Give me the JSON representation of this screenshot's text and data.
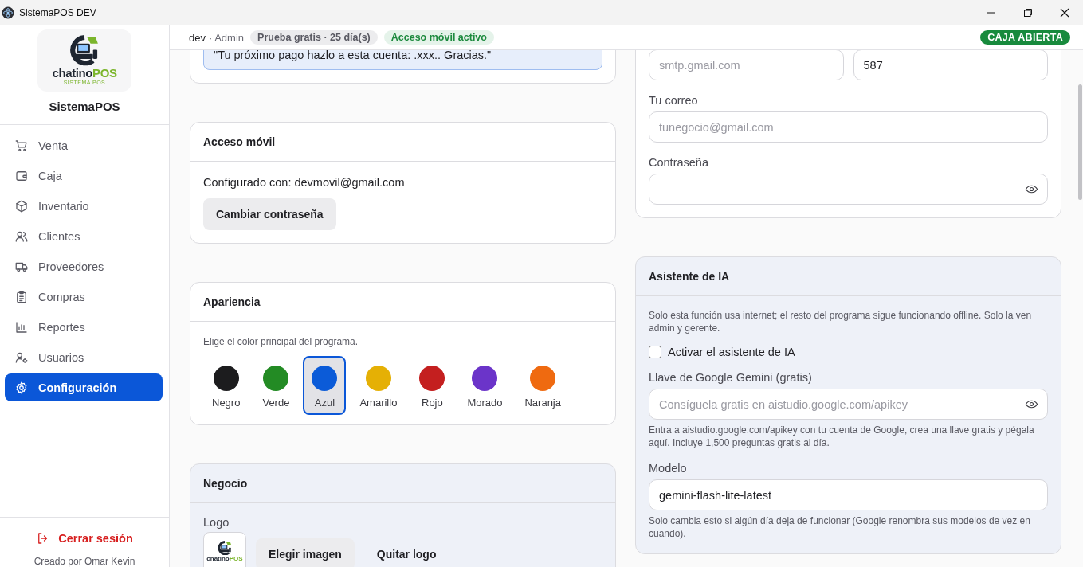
{
  "window": {
    "title": "SistemaPOS DEV"
  },
  "sidebar": {
    "logo": {
      "word": "chatino",
      "accent": "POS",
      "tagline": "SISTEMA POS"
    },
    "brand": "SistemaPOS",
    "items": [
      {
        "label": "Venta",
        "selected": false
      },
      {
        "label": "Caja",
        "selected": false
      },
      {
        "label": "Inventario",
        "selected": false
      },
      {
        "label": "Clientes",
        "selected": false
      },
      {
        "label": "Proveedores",
        "selected": false
      },
      {
        "label": "Compras",
        "selected": false
      },
      {
        "label": "Reportes",
        "selected": false
      },
      {
        "label": "Usuarios",
        "selected": false
      },
      {
        "label": "Configuración",
        "selected": true
      }
    ],
    "logout": "Cerrar sesión",
    "credit": "Creado por Omar Kevin"
  },
  "topbar": {
    "user": "dev",
    "role": "· Admin",
    "trial_badge": "Prueba gratis · 25 día(s)",
    "mobile_badge": "Acceso móvil activo",
    "cash_badge": "CAJA ABIERTA"
  },
  "message_card": {
    "message": "\"Tu próximo pago hazlo a esta cuenta: .xxx.. Gracias.\""
  },
  "mobile_access": {
    "title": "Acceso móvil",
    "configured": "Configurado con: devmovil@gmail.com",
    "button": "Cambiar contraseña"
  },
  "appearance": {
    "title": "Apariencia",
    "hint": "Elige el color principal del programa.",
    "colors": [
      {
        "label": "Negro",
        "color": "#1c1c1e",
        "selected": false
      },
      {
        "label": "Verde",
        "color": "#238b24",
        "selected": false
      },
      {
        "label": "Azul",
        "color": "#0b5bd8",
        "selected": true
      },
      {
        "label": "Amarillo",
        "color": "#e5b005",
        "selected": false
      },
      {
        "label": "Rojo",
        "color": "#c41f1f",
        "selected": false
      },
      {
        "label": "Morado",
        "color": "#6b34c9",
        "selected": false
      },
      {
        "label": "Naranja",
        "color": "#ef6a10",
        "selected": false
      }
    ]
  },
  "business": {
    "title": "Negocio",
    "logo_label": "Logo",
    "logo_thumb": {
      "word": "chatino",
      "accent": "POS"
    },
    "buttons": [
      {
        "label": "Elegir imagen",
        "kind": "filled"
      },
      {
        "label": "Quitar logo",
        "kind": "plain"
      }
    ]
  },
  "email_card": {
    "server_placeholder": "smtp.gmail.com",
    "port_value": "587",
    "email_label": "Tu correo",
    "email_placeholder": "tunegocio@gmail.com",
    "password_label": "Contraseña"
  },
  "ai": {
    "title": "Asistente de IA",
    "description": "Solo esta función usa internet; el resto del programa sigue funcionando offline. Solo la ven admin y gerente.",
    "checkbox": {
      "label": "Activar el asistente de IA",
      "checked": false
    },
    "key_label": "Llave de Google Gemini (gratis)",
    "key_placeholder": "Consíguela gratis en aistudio.google.com/apikey",
    "key_help": "Entra a aistudio.google.com/apikey con tu cuenta de Google, crea una llave gratis y pégala aquí. Incluye 1,500 preguntas gratis al día.",
    "model_label": "Modelo",
    "model_value": "gemini-flash-lite-latest",
    "model_help": "Solo cambia esto si algún día deja de funcionar (Google renombra sus modelos de vez en cuando)."
  }
}
